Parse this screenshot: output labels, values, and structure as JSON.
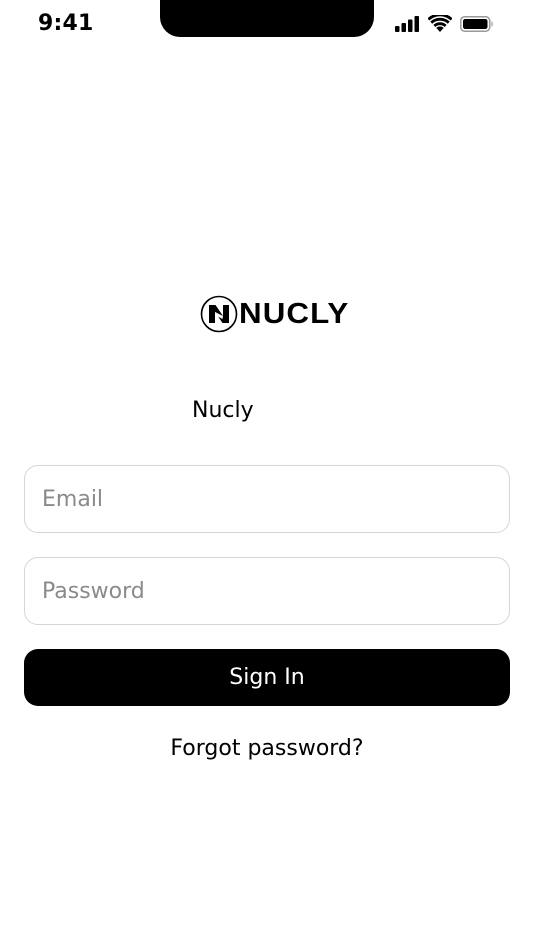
{
  "status_bar": {
    "time": "9:41",
    "icons": [
      "cellular-signal-icon",
      "wifi-icon",
      "battery-icon"
    ]
  },
  "logo": {
    "wordmark": "NUCLY"
  },
  "brand": {
    "name": "Nucly"
  },
  "form": {
    "email_placeholder": "Email",
    "email_value": "",
    "password_placeholder": "Password",
    "password_value": "",
    "sign_in_label": "Sign In",
    "forgot_password_label": "Forgot password?"
  },
  "colors": {
    "background": "#ffffff",
    "primary": "#000000",
    "field_border": "#d6d6d6",
    "placeholder": "#8a8a8a"
  }
}
